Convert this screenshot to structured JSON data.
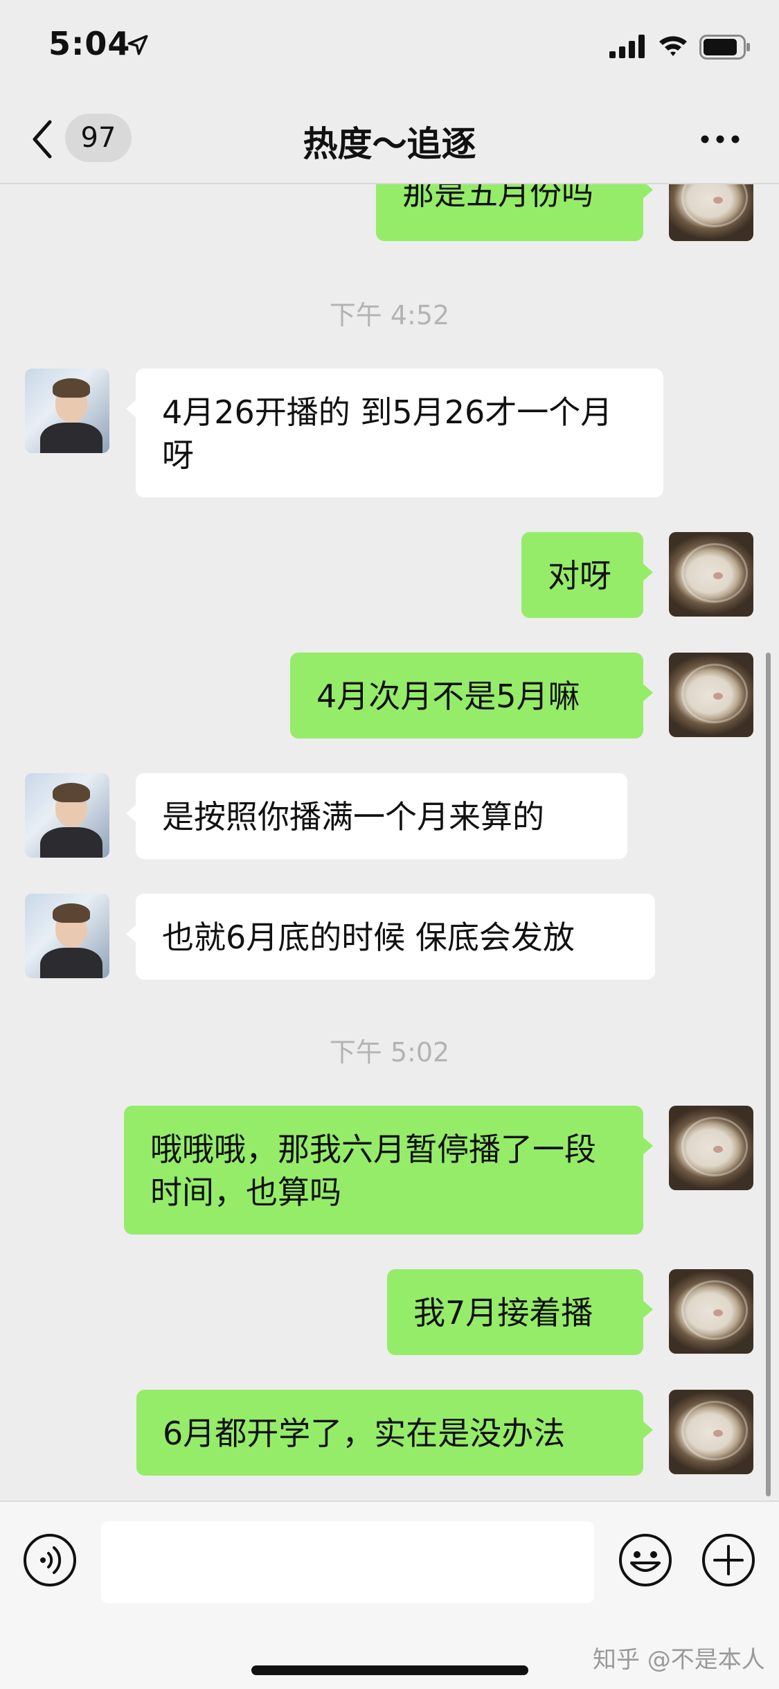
{
  "status_bar": {
    "time": "5:04"
  },
  "nav": {
    "unread_count": "97",
    "title": "热度～追逐"
  },
  "messages": [
    {
      "side": "mine",
      "text": "那是五月份吗"
    },
    {
      "type": "time",
      "text": "下午 4:52"
    },
    {
      "side": "theirs",
      "text": "4月26开播的 到5月26才一个月呀"
    },
    {
      "side": "mine",
      "text": "对呀"
    },
    {
      "side": "mine",
      "text": "4月次月不是5月嘛"
    },
    {
      "side": "theirs",
      "text": "是按照你播满一个月来算的"
    },
    {
      "side": "theirs",
      "text": "也就6月底的时候 保底会发放"
    },
    {
      "type": "time",
      "text": "下午 5:02"
    },
    {
      "side": "mine",
      "text": "哦哦哦，那我六月暂停播了一段时间，也算吗"
    },
    {
      "side": "mine",
      "text": "我7月接着播"
    },
    {
      "side": "mine",
      "text": "6月都开学了，实在是没办法"
    }
  ],
  "input": {
    "value": ""
  },
  "watermark": "知乎 @不是本人",
  "colors": {
    "my_bubble": "#95ec69",
    "their_bubble": "#ffffff",
    "background": "#ededed"
  },
  "icons": [
    "location-arrow-icon",
    "signal-icon",
    "wifi-icon",
    "battery-icon",
    "back-chevron-icon",
    "more-dots-icon",
    "voice-icon",
    "emoji-icon",
    "plus-icon"
  ]
}
